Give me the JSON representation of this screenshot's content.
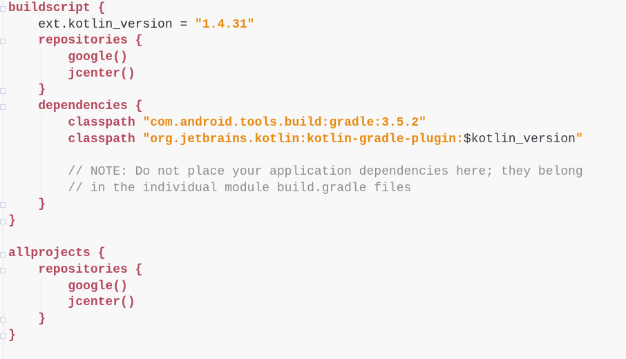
{
  "editor": {
    "language": "gradle",
    "colors": {
      "background": "#f8f8f8",
      "keyword": "#b5485d",
      "string": "#e88a10",
      "comment": "#8c8c8c",
      "text": "#2b2b2b"
    },
    "lines": [
      [
        [
          "kw",
          "buildscript {"
        ]
      ],
      [
        [
          "tx",
          "    ext.kotlin_version = "
        ],
        [
          "str",
          "\"1.4.31\""
        ]
      ],
      [
        [
          "kw",
          "    repositories {"
        ]
      ],
      [
        [
          "kw",
          "        google()"
        ]
      ],
      [
        [
          "kw",
          "        jcenter()"
        ]
      ],
      [
        [
          "kw",
          "    }"
        ]
      ],
      [
        [
          "kw",
          "    dependencies {"
        ]
      ],
      [
        [
          "kw",
          "        classpath "
        ],
        [
          "str",
          "\"com.android.tools.build:gradle:3.5.2\""
        ]
      ],
      [
        [
          "kw",
          "        classpath "
        ],
        [
          "str",
          "\"org.jetbrains.kotlin:kotlin-gradle-plugin:"
        ],
        [
          "var",
          "$kotlin_version"
        ],
        [
          "str",
          "\""
        ]
      ],
      [
        [
          "tx",
          ""
        ]
      ],
      [
        [
          "cm",
          "        // NOTE: Do not place your application dependencies here; they belong"
        ]
      ],
      [
        [
          "cm",
          "        // in the individual module build.gradle files"
        ]
      ],
      [
        [
          "kw",
          "    }"
        ]
      ],
      [
        [
          "kw",
          "}"
        ]
      ],
      [
        [
          "tx",
          ""
        ]
      ],
      [
        [
          "kw",
          "allprojects {"
        ]
      ],
      [
        [
          "kw",
          "    repositories {"
        ]
      ],
      [
        [
          "kw",
          "        google()"
        ]
      ],
      [
        [
          "kw",
          "        jcenter()"
        ]
      ],
      [
        [
          "kw",
          "    }"
        ]
      ],
      [
        [
          "kw",
          "}"
        ]
      ]
    ],
    "fold_lines": [
      0,
      2,
      5,
      6,
      12,
      13,
      15,
      16,
      19,
      20
    ]
  }
}
